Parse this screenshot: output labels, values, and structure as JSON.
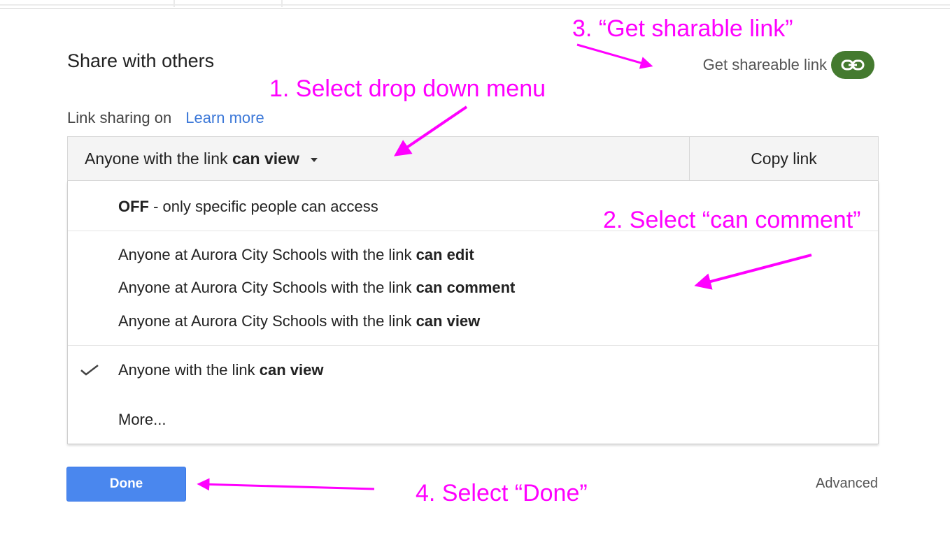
{
  "dialog": {
    "title": "Share with others",
    "get_shareable_link": "Get shareable link",
    "link_sharing_status": "Link sharing on",
    "learn_more": "Learn more",
    "dropdown": {
      "selected_prefix": "Anyone with the link",
      "selected_bold": "can view"
    },
    "copy_link": "Copy link",
    "menu": {
      "off_item": {
        "bold": "OFF",
        "rest": " - only specific people can access"
      },
      "domain_items": [
        {
          "prefix": "Anyone at Aurora City Schools with the link ",
          "bold": "can edit"
        },
        {
          "prefix": "Anyone at Aurora City Schools with the link ",
          "bold": "can comment"
        },
        {
          "prefix": "Anyone at Aurora City Schools with the link ",
          "bold": "can view"
        }
      ],
      "public_item": {
        "prefix": "Anyone with the link ",
        "bold": "can view",
        "checked": true
      },
      "more_item": "More..."
    },
    "done_button": "Done",
    "advanced": "Advanced",
    "link_icon_color": "#447a2f",
    "done_color": "#4a87ee",
    "link_color": "#3c78d8"
  },
  "annotations": {
    "step1": "1. Select drop down menu",
    "step2": "2. Select “can comment”",
    "step3": "3. “Get sharable link”",
    "step4": "4. Select “Done”",
    "color": "#ff00ff"
  }
}
